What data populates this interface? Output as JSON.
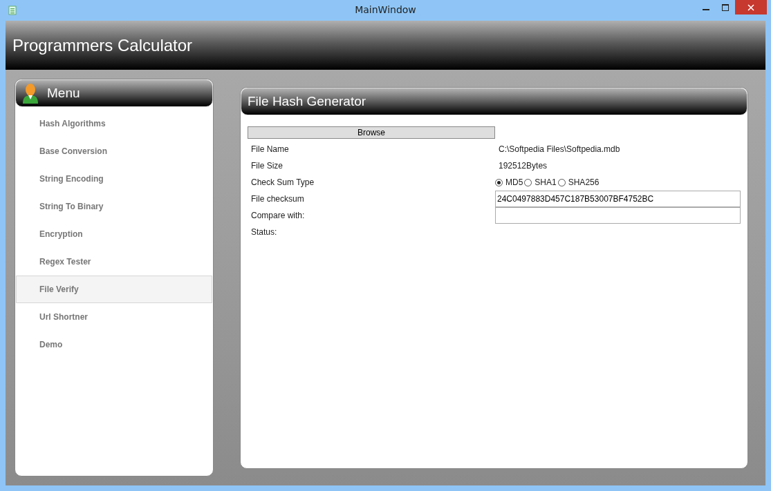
{
  "window": {
    "title": "MainWindow"
  },
  "header": {
    "title": "Programmers Calculator"
  },
  "sidebar": {
    "title": "Menu",
    "items": [
      {
        "label": "Hash Algorithms",
        "selected": false
      },
      {
        "label": "Base Conversion",
        "selected": false
      },
      {
        "label": "String Encoding",
        "selected": false
      },
      {
        "label": "String To Binary",
        "selected": false
      },
      {
        "label": "Encryption",
        "selected": false
      },
      {
        "label": "Regex Tester",
        "selected": false
      },
      {
        "label": "File Verify",
        "selected": true
      },
      {
        "label": "Url Shortner",
        "selected": false
      },
      {
        "label": "Demo",
        "selected": false
      }
    ]
  },
  "panel": {
    "title": "File Hash Generator",
    "browse_button": "Browse",
    "rows": [
      {
        "label": "File Name",
        "kind": "text",
        "value": "C:\\Softpedia Files\\Softpedia.mdb"
      },
      {
        "label": "File Size",
        "kind": "text",
        "value": "192512Bytes"
      },
      {
        "label": "Check Sum Type",
        "kind": "radio",
        "options": [
          {
            "label": "MD5",
            "selected": true
          },
          {
            "label": "SHA1",
            "selected": false
          },
          {
            "label": "SHA256",
            "selected": false
          }
        ]
      },
      {
        "label": "File checksum",
        "kind": "field",
        "value": "24C0497883D457C187B53007BF4752BC"
      },
      {
        "label": "Compare with:",
        "kind": "field",
        "value": ""
      },
      {
        "label": "Status:",
        "kind": "text",
        "value": ""
      }
    ]
  }
}
